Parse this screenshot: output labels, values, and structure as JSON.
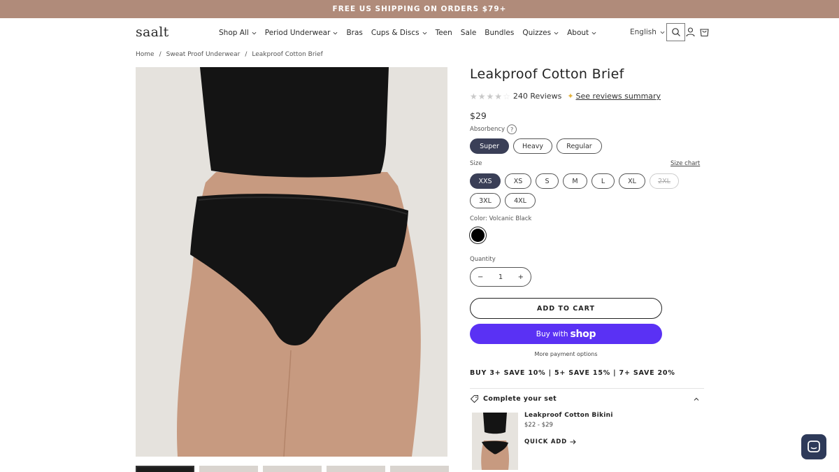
{
  "announcement": "FREE US SHIPPING ON ORDERS $79+",
  "header": {
    "logo": "saalt",
    "nav": [
      {
        "label": "Shop All",
        "dropdown": true
      },
      {
        "label": "Period Underwear",
        "dropdown": true
      },
      {
        "label": "Bras",
        "dropdown": false
      },
      {
        "label": "Cups & Discs",
        "dropdown": true
      },
      {
        "label": "Teen",
        "dropdown": false
      },
      {
        "label": "Sale",
        "dropdown": false
      },
      {
        "label": "Bundles",
        "dropdown": false
      },
      {
        "label": "Quizzes",
        "dropdown": true
      },
      {
        "label": "About",
        "dropdown": true
      }
    ],
    "language": "English",
    "icons": [
      "search-icon",
      "account-icon",
      "cart-icon"
    ]
  },
  "breadcrumb": [
    "Home",
    "Sweat Proof Underwear",
    "Leakproof Cotton Brief"
  ],
  "product": {
    "title": "Leakproof Cotton Brief",
    "rating": 4,
    "reviews": "240 Reviews",
    "summary_link": "See reviews summary",
    "price": "$29",
    "absorbency_label": "Absorbency",
    "absorbency_help": "?",
    "absorbency": [
      "Super",
      "Heavy",
      "Regular"
    ],
    "absorbency_selected": "Super",
    "size_label": "Size",
    "size_chart": "Size chart",
    "sizes_row1": [
      "XXS",
      "XS",
      "S",
      "M",
      "L",
      "XL",
      "2XL"
    ],
    "sizes_row2": [
      "3XL",
      "4XL"
    ],
    "size_selected": "XXS",
    "size_unavailable": [
      "2XL"
    ],
    "color_label": "Color: Volcanic Black",
    "color_hex": "#000000",
    "quantity_label": "Quantity",
    "quantity": "1",
    "qty_minus": "−",
    "qty_plus": "+",
    "add_to_cart": "ADD TO CART",
    "buy_with": "Buy with",
    "shop_brand": "shop",
    "more_payment": "More payment options",
    "promo": "BUY 3+ SAVE 10% | 5+ SAVE 15% | 7+ SAVE 20%"
  },
  "complete_set": {
    "heading": "Complete your set",
    "item_name": "Leakproof Cotton Bikini",
    "item_price": "$22 - $29",
    "quick_add": "QUICK ADD"
  },
  "colors": {
    "announcement_bg": "#b08b7a",
    "selected_pill": "#3a3f57",
    "shop_pay": "#5a31f4",
    "chat": "#2e3a59"
  }
}
